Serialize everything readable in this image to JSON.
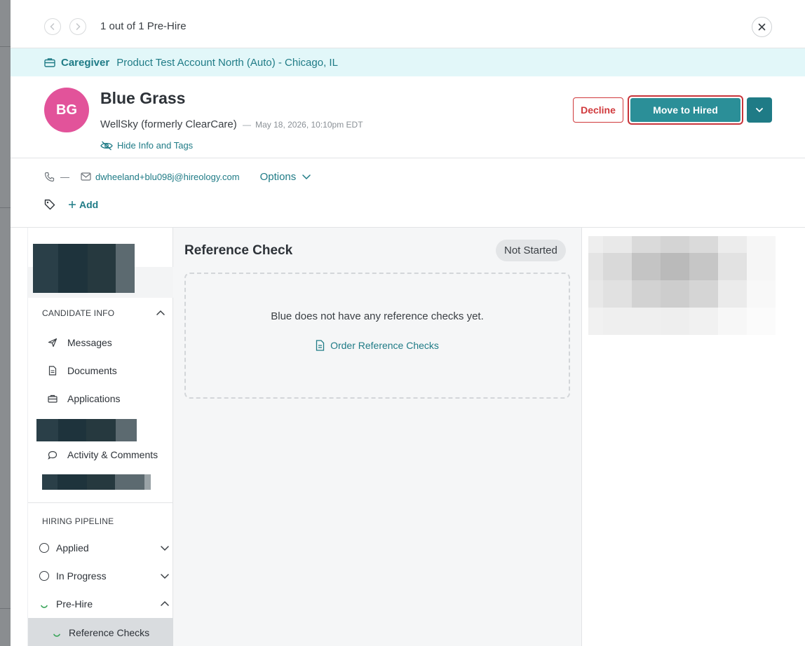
{
  "nav": {
    "count_text": "1 out of 1 Pre-Hire"
  },
  "job": {
    "title": "Caregiver",
    "location": "Product Test Account North (Auto) - Chicago, IL"
  },
  "candidate": {
    "initials": "BG",
    "name": "Blue Grass",
    "source": "WellSky (formerly ClearCare)",
    "separator": "—",
    "timestamp": "May 18, 2026, 10:10pm EDT",
    "hide_info_label": "Hide Info and Tags",
    "avatar_color": "#e2539a"
  },
  "actions": {
    "decline_label": "Decline",
    "move_label": "Move to Hired"
  },
  "contact": {
    "phone": "—",
    "email": "dwheeland+blu098j@hireology.com",
    "options_label": "Options"
  },
  "tags": {
    "add_label": "Add"
  },
  "sidebar": {
    "candidate_info_title": "CANDIDATE INFO",
    "items": [
      {
        "label": "Messages",
        "icon": "send-icon"
      },
      {
        "label": "Documents",
        "icon": "document-icon"
      },
      {
        "label": "Applications",
        "icon": "briefcase-icon"
      },
      {
        "label": "Activity & Comments",
        "icon": "comment-icon"
      }
    ],
    "pipeline_title": "HIRING PIPELINE",
    "pipeline": [
      {
        "label": "Applied"
      },
      {
        "label": "In Progress"
      },
      {
        "label": "Pre-Hire"
      }
    ],
    "pipeline_sub": [
      {
        "label": "Reference Checks"
      }
    ]
  },
  "main": {
    "title": "Reference Check",
    "status": "Not Started",
    "empty_message": "Blue does not have any reference checks yet.",
    "order_link": "Order Reference Checks"
  },
  "colors": {
    "accent": "#1f7b86",
    "primary_button": "#2b8f98",
    "danger": "#d0393c",
    "banner_bg": "#e2f7f9"
  }
}
